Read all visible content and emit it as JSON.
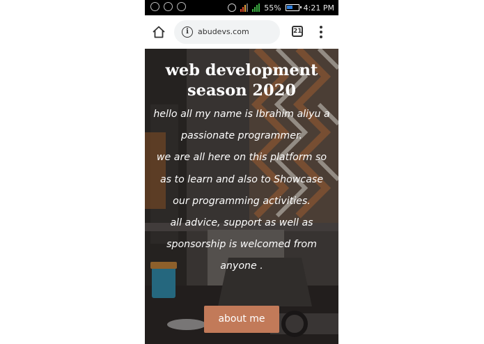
{
  "status_bar": {
    "icons": [
      "whatsapp-icon",
      "messenger-icon",
      "opera-icon",
      "alarm-icon",
      "signal-icon",
      "battery-icon"
    ],
    "battery_percent": "55%",
    "time": "4:21 PM"
  },
  "browser": {
    "url": "abudevs.com",
    "tab_count": "21"
  },
  "hero": {
    "title_line1": "web development",
    "title_line2": "season 2020",
    "body_lines": [
      "hello all my name is Ibrahim aliyu a",
      "passionate programmer.",
      "we are all here on this platform so",
      "as to learn and also to Showcase",
      "our programming activities.",
      "all advice, support as well as",
      "sponsorship is welcomed from",
      "anyone ."
    ],
    "button_label": "about me"
  },
  "colors": {
    "accent_button": "#c27a59",
    "status_bar_bg": "#000000",
    "url_bar_bg": "#f1f3f4"
  }
}
